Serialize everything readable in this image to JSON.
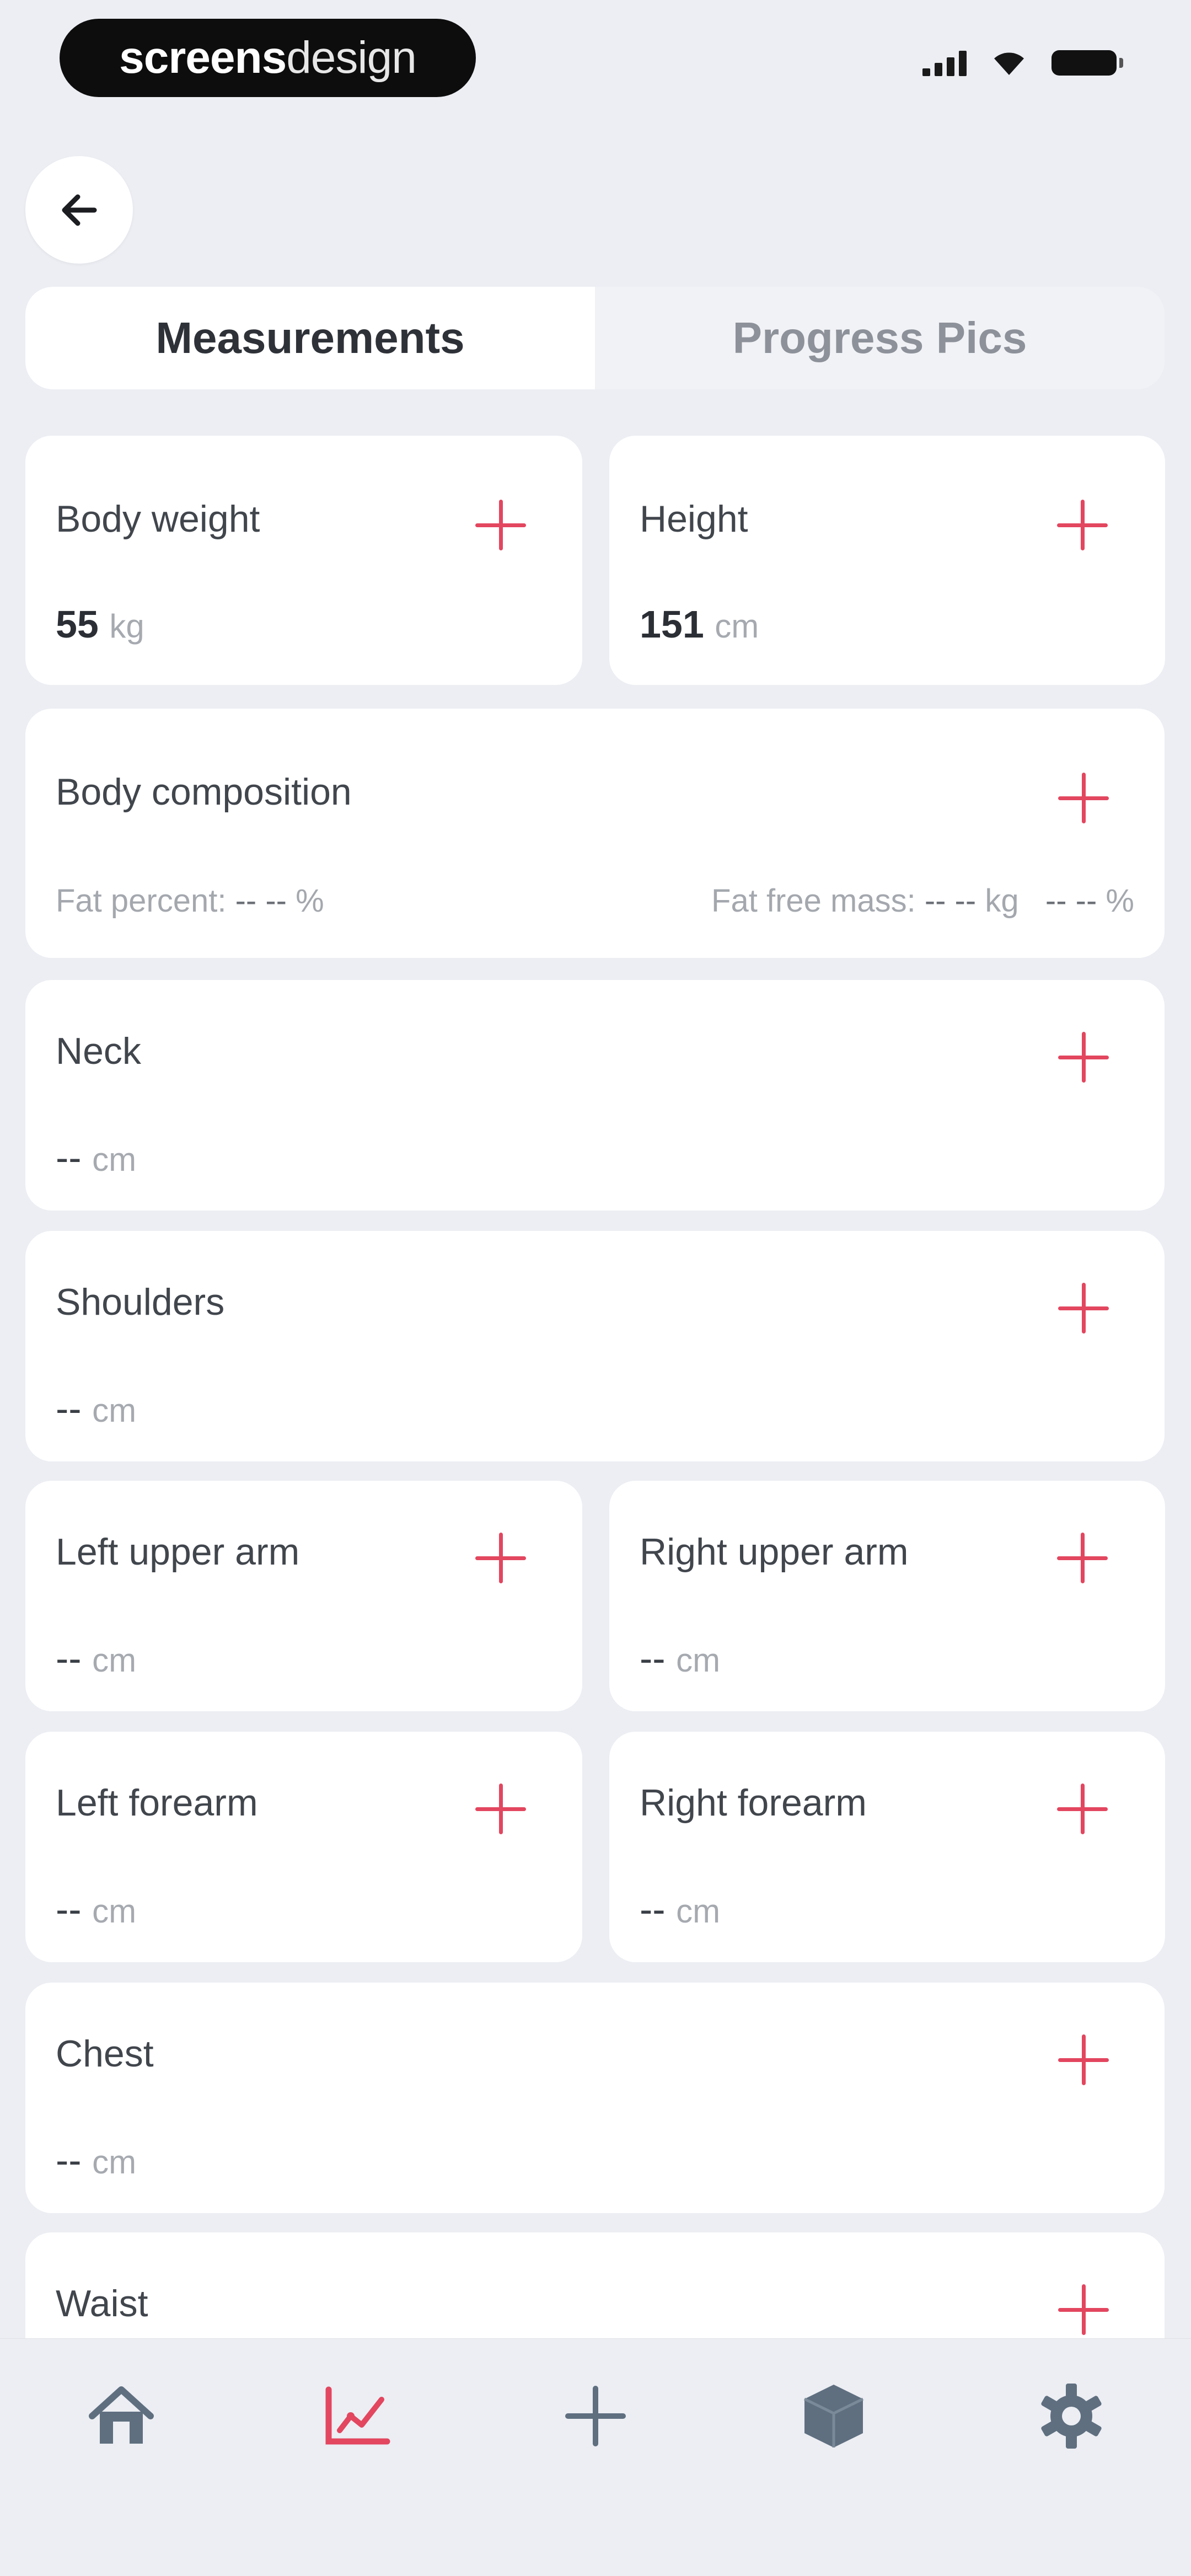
{
  "status_bar": {
    "brand_bold": "screens",
    "brand_rest": "design",
    "icons": [
      "signal-icon",
      "wifi-icon",
      "battery-icon"
    ]
  },
  "header": {
    "back_icon": "arrow-left-icon"
  },
  "tabs": {
    "measurements": "Measurements",
    "progress_pics": "Progress Pics",
    "active": "measurements"
  },
  "cards": {
    "body_weight": {
      "label": "Body weight",
      "value": "55",
      "unit": "kg"
    },
    "height": {
      "label": "Height",
      "value": "151",
      "unit": "cm"
    },
    "body_composition": {
      "label": "Body composition",
      "fat_percent_label": "Fat percent:",
      "fat_percent_value": "-- --",
      "fat_percent_unit": "%",
      "fat_free_label": "Fat free mass:",
      "fat_free_value": "-- --",
      "fat_free_unit": "kg",
      "fat_free_pct_value": "-- --",
      "fat_free_pct_unit": "%"
    },
    "neck": {
      "label": "Neck",
      "value": "--",
      "unit": "cm"
    },
    "shoulders": {
      "label": "Shoulders",
      "value": "--",
      "unit": "cm"
    },
    "left_upper_arm": {
      "label": "Left upper arm",
      "value": "--",
      "unit": "cm"
    },
    "right_upper_arm": {
      "label": "Right upper arm",
      "value": "--",
      "unit": "cm"
    },
    "left_forearm": {
      "label": "Left forearm",
      "value": "--",
      "unit": "cm"
    },
    "right_forearm": {
      "label": "Right forearm",
      "value": "--",
      "unit": "cm"
    },
    "chest": {
      "label": "Chest",
      "value": "--",
      "unit": "cm"
    },
    "waist": {
      "label": "Waist"
    }
  },
  "bottom_nav": {
    "items": [
      "home-icon",
      "progress-chart-icon",
      "add-icon",
      "cube-icon",
      "settings-gear-icon"
    ],
    "active": "progress-chart-icon"
  },
  "colors": {
    "accent": "#e3465f",
    "background": "#eceef3",
    "card": "#ffffff",
    "icon_gray": "#5f6f80"
  }
}
